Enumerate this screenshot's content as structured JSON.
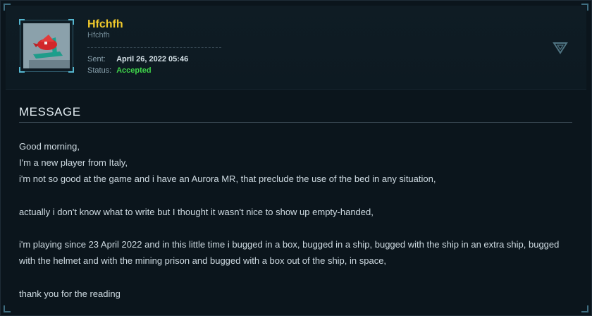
{
  "sender": {
    "name": "Hfchfh",
    "handle": "Hfchfh"
  },
  "meta": {
    "sent_label": "Sent:",
    "sent_value": "April 26, 2022 05:46",
    "status_label": "Status:",
    "status_value": "Accepted",
    "status_color": "#3fd44a"
  },
  "accent_color": "#f0c92c",
  "icons": {
    "collapse": "triangle-down-icon"
  },
  "message": {
    "title": "MESSAGE",
    "lines": [
      "Good morning,",
      "I'm a new player from Italy,",
      "i'm not so good at the game and i have an Aurora MR, that preclude the use of the bed in any situation,",
      "actually i don't know what to write but I thought it wasn't nice to show up empty-handed,",
      "i'm playing since 23 April 2022 and in this little time i bugged in a box, bugged in a ship, bugged with the ship in an extra ship, bugged",
      "with the helmet and with the mining prison and bugged with a box out of the ship, in space,",
      "thank you for the reading"
    ]
  }
}
